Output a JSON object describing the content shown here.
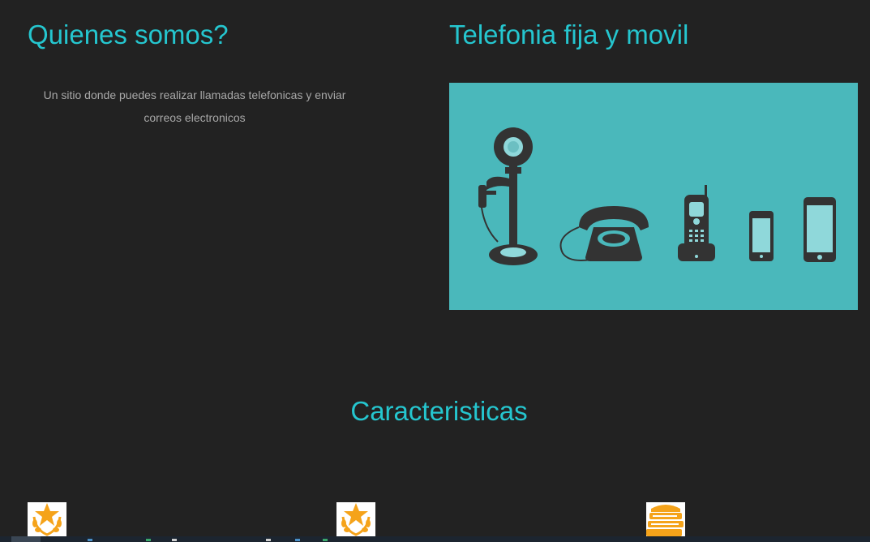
{
  "about": {
    "heading": "Quienes somos?",
    "text": "Un sitio donde puedes realizar llamadas telefonicas y enviar correos electronicos"
  },
  "phones": {
    "heading": "Telefonia fija y movil",
    "illustration_icon": "phone-evolution-illustration"
  },
  "features": {
    "heading": "Caracteristicas",
    "icons": [
      "award-star-icon",
      "award-star-icon",
      "books-stack-icon"
    ]
  },
  "colors": {
    "background": "#222222",
    "heading": "#25c6cf",
    "body_text": "#a8a8a8",
    "illustration_bg": "#4ab8bb",
    "illustration_fg": "#333333",
    "icon_accent": "#f5a31a"
  }
}
